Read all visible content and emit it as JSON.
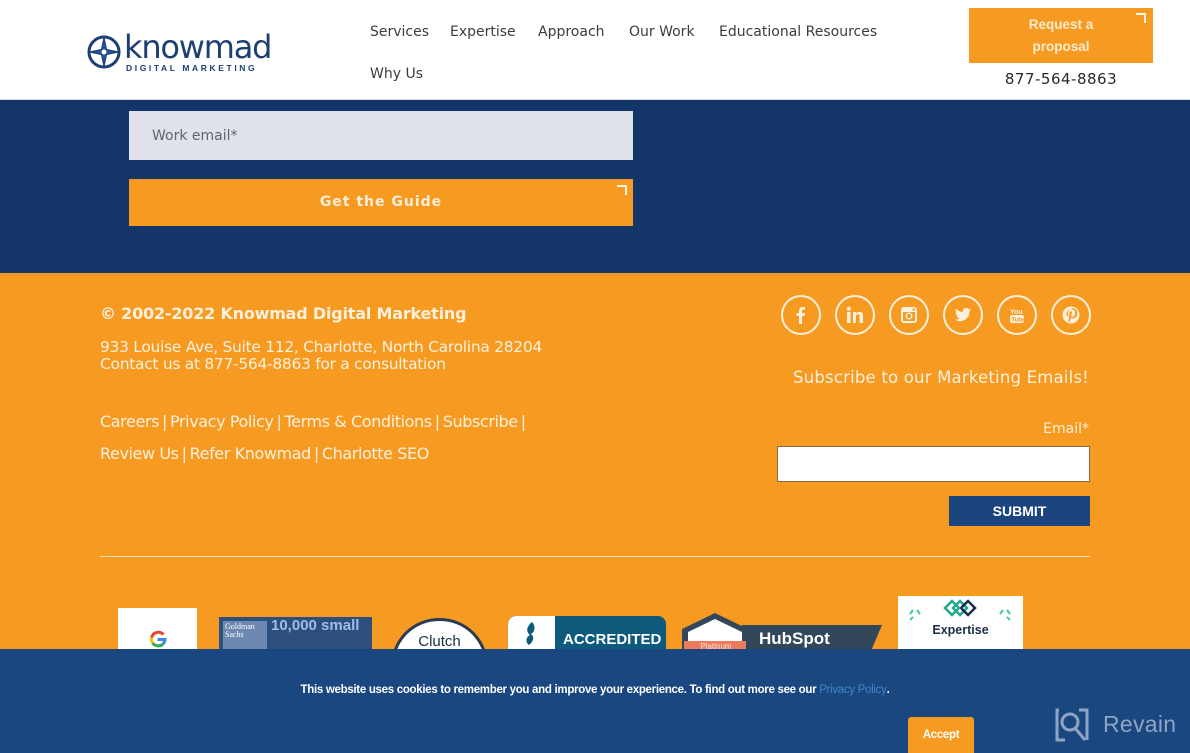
{
  "header": {
    "logo": {
      "name": "knowmad",
      "tagline": "DIGITAL MARKETING"
    },
    "nav": [
      {
        "label": "Services"
      },
      {
        "label": "Expertise"
      },
      {
        "label": "Approach"
      },
      {
        "label": "Our Work"
      },
      {
        "label": "Educational Resources"
      },
      {
        "label": "Why Us"
      }
    ],
    "cta_label_line1": "Request a",
    "cta_label_line2": "proposal",
    "phone": "877-564-8863"
  },
  "guide_form": {
    "email_placeholder": "Work email*",
    "email_value": "",
    "submit_label": "Get the Guide"
  },
  "footer": {
    "copyright": "© 2002-2022  Knowmad Digital Marketing",
    "address_line": "933 Louise Ave, Suite 112, Charlotte, North Carolina 28204",
    "contact_line": "Contact us at 877-564-8863 for a consultation",
    "links": [
      {
        "label": "Careers"
      },
      {
        "label": "Privacy Policy"
      },
      {
        "label": "Terms & Conditions"
      },
      {
        "label": "Subscribe"
      },
      {
        "label": "Review Us"
      },
      {
        "label": "Refer Knowmad"
      },
      {
        "label": "Charlotte SEO"
      }
    ],
    "link_separator": "|",
    "social": [
      {
        "icon": "facebook-icon"
      },
      {
        "icon": "linkedin-icon"
      },
      {
        "icon": "instagram-icon"
      },
      {
        "icon": "twitter-icon"
      },
      {
        "icon": "youtube-icon"
      },
      {
        "icon": "pinterest-icon"
      }
    ],
    "subscribe": {
      "title": "Subscribe to our Marketing Emails!",
      "email_label": "Email*",
      "email_value": "",
      "submit_label": "SUBMIT"
    },
    "badges": [
      {
        "name": "Google Partner",
        "text": "G"
      },
      {
        "name": "Goldman Sachs 10,000 Small Businesses",
        "brand": "Goldman Sachs",
        "text": "10,000 small"
      },
      {
        "name": "Clutch",
        "text": "Clutch"
      },
      {
        "name": "BBB Accredited",
        "text": "ACCREDITED"
      },
      {
        "name": "HubSpot Platinum",
        "text": "HubSpot",
        "tier": "Platinum"
      },
      {
        "name": "Expertise",
        "text": "Expertise"
      }
    ]
  },
  "cookie_banner": {
    "text": "This website uses cookies to remember you and improve your experience. To find out more see our ",
    "link_label": "Privacy Policy",
    "suffix": ".",
    "accept_label": "Accept"
  },
  "watermark": {
    "label": "Revain"
  },
  "colors": {
    "brand_orange": "#f69a21",
    "brand_navy": "#14356a",
    "cookie_blue": "#1b4781",
    "submit_blue": "#1c4580",
    "link_blue": "#3e86c8"
  }
}
